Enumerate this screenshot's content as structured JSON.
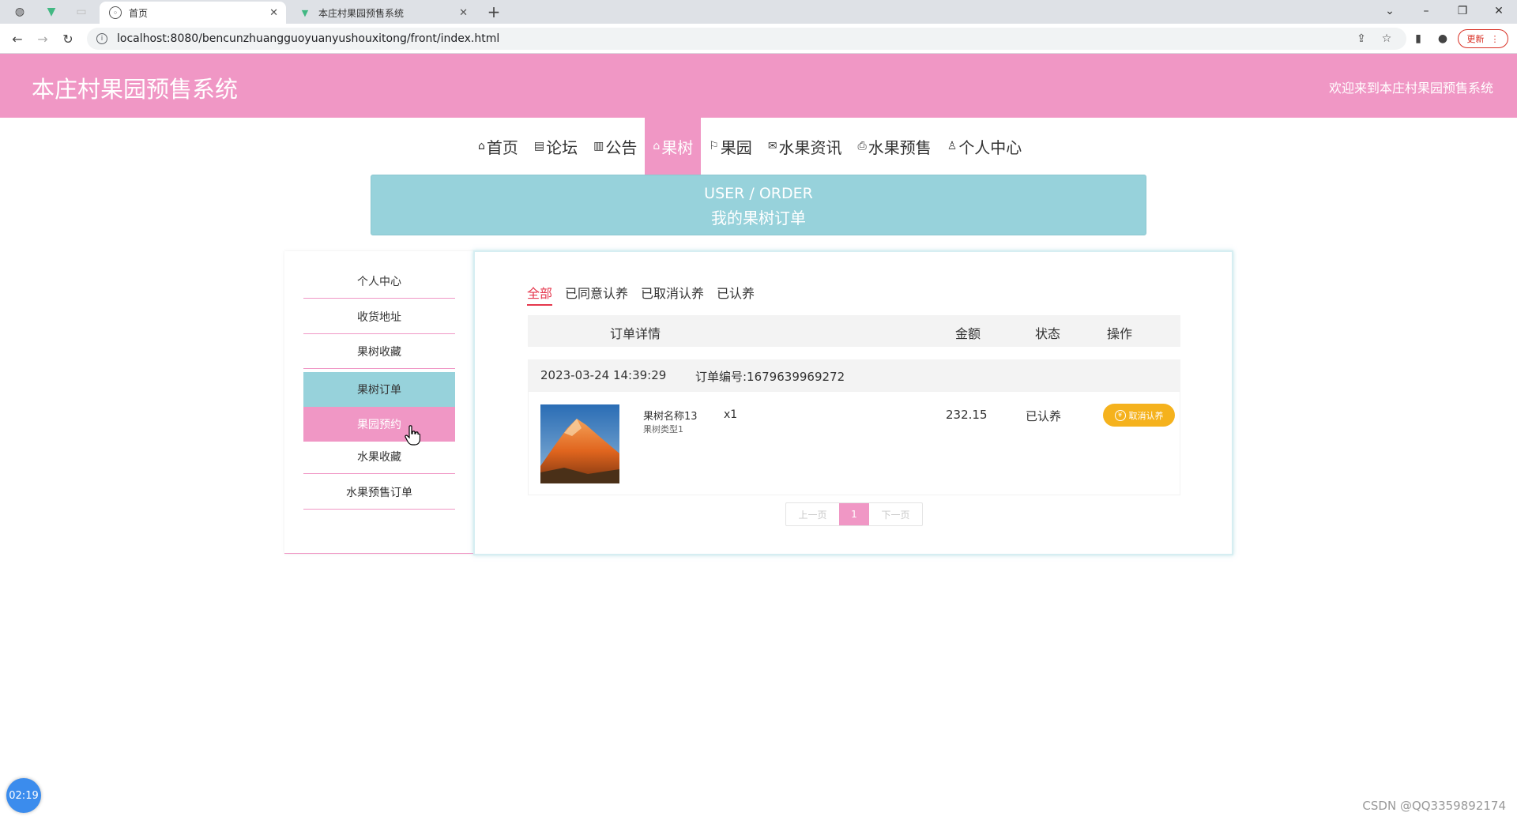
{
  "browser": {
    "tabs": [
      {
        "title": "首页"
      },
      {
        "title": "本庄村果园预售系统"
      }
    ],
    "new_tab": "+",
    "url": "localhost:8080/bencunzhuangguoyuanyushouxitong/front/index.html",
    "update_label": "更新",
    "controls": {
      "minimize": "–",
      "restore": "❐",
      "close": "✕",
      "tab_search": "⌄"
    }
  },
  "header": {
    "title": "本庄村果园预售系统",
    "welcome": "欢迎来到本庄村果园预售系统"
  },
  "nav": {
    "items": [
      {
        "icon": "⌂",
        "label": "首页"
      },
      {
        "icon": "▤",
        "label": "论坛"
      },
      {
        "icon": "▥",
        "label": "公告"
      },
      {
        "icon": "⌂",
        "label": "果树"
      },
      {
        "icon": "⚐",
        "label": "果园"
      },
      {
        "icon": "✉",
        "label": "水果资讯"
      },
      {
        "icon": "⎙",
        "label": "水果预售"
      },
      {
        "icon": "♙",
        "label": "个人中心"
      }
    ],
    "active_index": 3
  },
  "banner": {
    "en": "USER / ORDER",
    "zh": "我的果树订单"
  },
  "side_menu": {
    "items": [
      "个人中心",
      "收货地址",
      "果树收藏",
      "果树订单",
      "果园预约",
      "水果收藏",
      "水果预售订单"
    ]
  },
  "filters": [
    "全部",
    "已同意认养",
    "已取消认养",
    "已认养"
  ],
  "table": {
    "headers": {
      "detail": "订单详情",
      "amount": "金额",
      "status": "状态",
      "action": "操作"
    }
  },
  "order": {
    "time": "2023-03-24 14:39:29",
    "number": "订单编号:1679639969272",
    "product_name": "果树名称13",
    "product_type": "果树类型1",
    "quantity": "x1",
    "amount": "232.15",
    "status": "已认养",
    "action": "取消认养"
  },
  "pager": {
    "prev": "上一页",
    "page": "1",
    "next": "下一页"
  },
  "overlay": {
    "timer": "02:19",
    "watermark": "CSDN @QQ3359892174"
  },
  "colors": {
    "pink": "#f097c5",
    "teal": "#97d2db",
    "orange": "#f5b21d",
    "red": "#e5374d"
  }
}
